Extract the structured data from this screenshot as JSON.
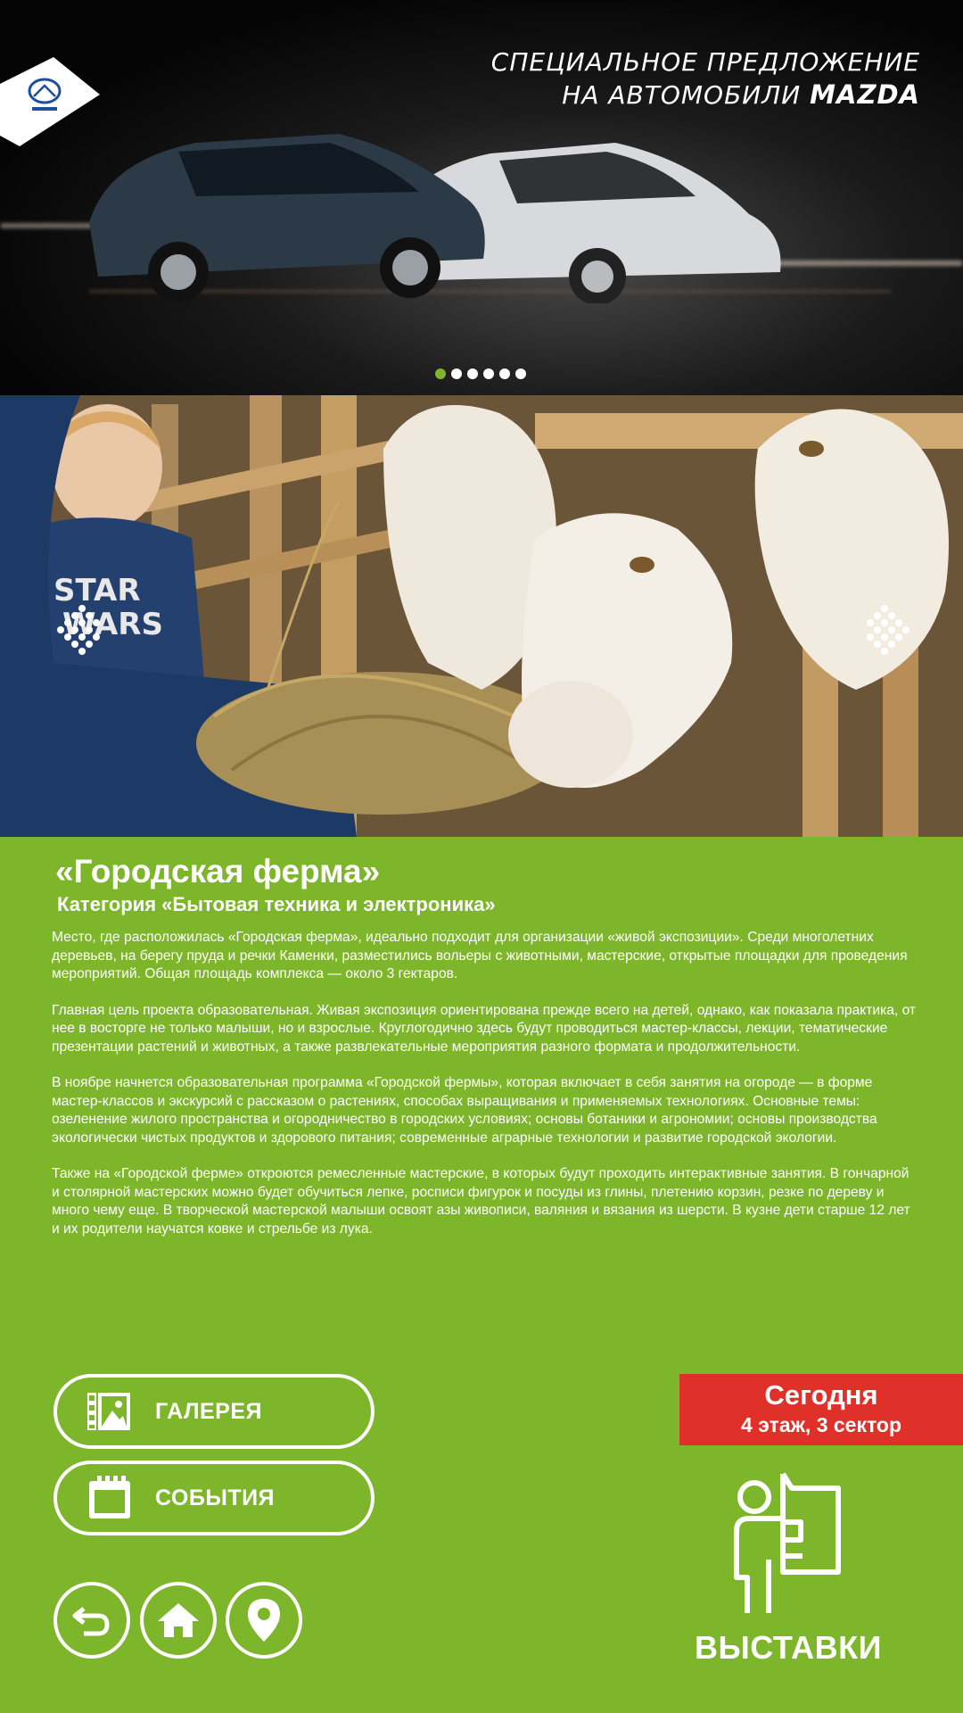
{
  "banner": {
    "headline_line1": "Специальное предложение",
    "headline_line2_prefix": "на автомобили ",
    "headline_line2_brand": "MAZDA",
    "logo_icon": "mazda-logo",
    "slides": 6,
    "active_slide": 1
  },
  "photo": {
    "prev_icon": "arrow-left-icon",
    "next_icon": "arrow-right-icon"
  },
  "article": {
    "title": "«Городская ферма»",
    "subtitle": "Категория «Бытовая техника и электроника»",
    "paragraphs": [
      "Место, где расположилась «Городская ферма», идеально подходит для организации «живой экспозиции». Среди многолетних деревьев, на берегу пруда и речки Каменки, разместились вольеры с животными, мастерские, открытые площадки для проведения мероприятий. Общая площадь комплекса — около 3 гектаров.",
      "Главная цель проекта образовательная. Живая экспозиция ориентирована прежде всего на детей, однако, как показала практика, от нее в восторге не только малыши, но и взрослые. Круглогодично здесь будут проводиться мастер-классы, лекции, тематические презентации растений и животных, а также развлекательные мероприятия разного формата и продолжительности.",
      "В ноябре начнется образовательная программа «Городской фермы», которая включает в себя занятия на огороде — в форме мастер-классов и экскурсий с рассказом о растениях, способах выращивания и применяемых технологиях. Основные темы: озеленение жилого пространства и огородничество в городских условиях; основы ботаники и агрономии; основы производства экологически чистых продуктов и здорового питания; современные аграрные технологии и развитие городской экологии.",
      "Также на «Городской ферме» откроются ремесленные мастерские, в которых будут проходить интерактивные занятия. В гончарной и столярной мастерских можно будет обучиться лепке, росписи фигурок и посуды из глины, плетению корзин, резке по дереву и много чему еще. В творческой мастерской малыши освоят азы живописи, валяния и вязания из шерсти. В кузне дети старше 12 лет и их родители научатся ковке и стрельбе из лука."
    ]
  },
  "buttons": {
    "gallery_label": "ГАЛЕРЕЯ",
    "gallery_icon": "gallery-icon",
    "events_label": "СОБЫТИЯ",
    "events_icon": "calendar-icon",
    "back_icon": "back-icon",
    "home_icon": "home-icon",
    "map_icon": "map-pin-icon"
  },
  "location": {
    "today": "Сегодня",
    "place": "4 этаж, 3 сектор"
  },
  "section": {
    "label": "ВЫСТАВКИ",
    "icon": "exhibition-icon"
  },
  "colors": {
    "background": "#7db62a",
    "accent_red": "#e0302a",
    "dot_active": "#7db62a"
  }
}
